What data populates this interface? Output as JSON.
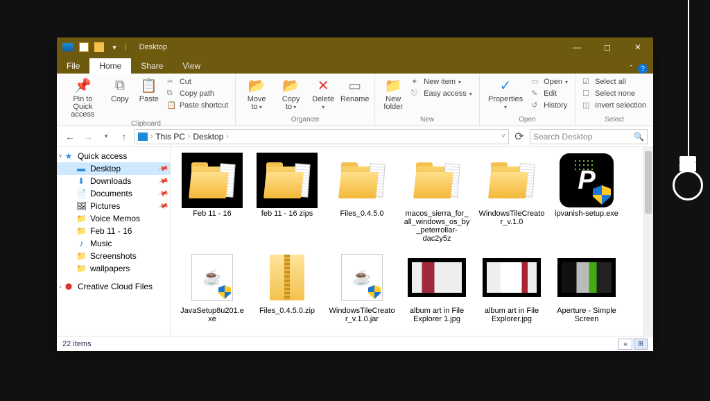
{
  "titlebar": {
    "title": "Desktop"
  },
  "tabs": {
    "file": "File",
    "home": "Home",
    "share": "Share",
    "view": "View"
  },
  "ribbon": {
    "pin": "Pin to Quick access",
    "copy": "Copy",
    "paste": "Paste",
    "cut": "Cut",
    "copypath": "Copy path",
    "pasteshortcut": "Paste shortcut",
    "moveto": "Move to",
    "copyto": "Copy to",
    "delete": "Delete",
    "rename": "Rename",
    "newfolder": "New folder",
    "newitem": "New item",
    "easyaccess": "Easy access",
    "properties": "Properties",
    "open": "Open",
    "edit": "Edit",
    "history": "History",
    "selectall": "Select all",
    "selectnone": "Select none",
    "invert": "Invert selection",
    "group_clipboard": "Clipboard",
    "group_organize": "Organize",
    "group_new": "New",
    "group_open": "Open",
    "group_select": "Select"
  },
  "breadcrumb": {
    "root": "This PC",
    "leaf": "Desktop"
  },
  "search": {
    "placeholder": "Search Desktop"
  },
  "nav": {
    "quick": "Quick access",
    "desktop": "Desktop",
    "downloads": "Downloads",
    "documents": "Documents",
    "pictures": "Pictures",
    "voice": "Voice Memos",
    "feb": "Feb 11 - 16",
    "music": "Music",
    "screenshots": "Screenshots",
    "wallpapers": "wallpapers",
    "ccf": "Creative Cloud Files"
  },
  "items": [
    {
      "label": "Feb 11 - 16",
      "kind": "folder-sel"
    },
    {
      "label": "feb 11 - 16 zips",
      "kind": "folder-sel"
    },
    {
      "label": "Files_0.4.5.0",
      "kind": "folder"
    },
    {
      "label": "macos_sierra_for_all_windows_os_by_peterrollar-dac2y5z",
      "kind": "folder"
    },
    {
      "label": "WindowsTileCreator_v.1.0",
      "kind": "folder"
    },
    {
      "label": "ipvanish-setup.exe",
      "kind": "app"
    },
    {
      "label": "JavaSetup8u201.exe",
      "kind": "java"
    },
    {
      "label": "Files_0.4.5.0.zip",
      "kind": "zip"
    },
    {
      "label": "WindowsTileCreator_v.1.0.jar",
      "kind": "java"
    },
    {
      "label": "album art in File Explorer 1.jpg",
      "kind": "imga"
    },
    {
      "label": "album art in File Explorer.jpg",
      "kind": "imgb"
    },
    {
      "label": "Aperture - Simple Screen",
      "kind": "imgc"
    }
  ],
  "status": {
    "count": "22 items"
  }
}
